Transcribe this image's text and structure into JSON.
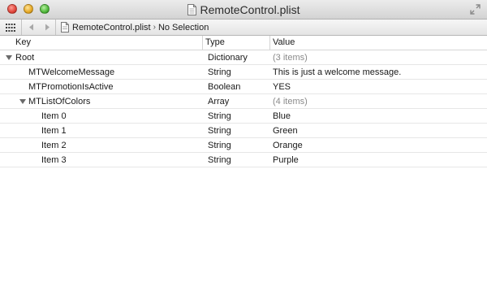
{
  "window": {
    "title": "RemoteControl.plist"
  },
  "jumpbar": {
    "file": "RemoteControl.plist",
    "selection": "No Selection",
    "separator": "›"
  },
  "columns": {
    "key": "Key",
    "type": "Type",
    "value": "Value"
  },
  "rows": [
    {
      "key": "Root",
      "type": "Dictionary",
      "value": "(3 items)",
      "indent": 0,
      "disclosure": "expanded",
      "value_muted": true
    },
    {
      "key": "MTWelcomeMessage",
      "type": "String",
      "value": "This is just a welcome message.",
      "indent": 1,
      "disclosure": "none",
      "value_muted": false
    },
    {
      "key": "MTPromotionIsActive",
      "type": "Boolean",
      "value": "YES",
      "indent": 1,
      "disclosure": "none",
      "value_muted": false
    },
    {
      "key": "MTListOfColors",
      "type": "Array",
      "value": "(4 items)",
      "indent": 1,
      "disclosure": "expanded",
      "value_muted": true
    },
    {
      "key": "Item 0",
      "type": "String",
      "value": "Blue",
      "indent": 2,
      "disclosure": "none",
      "value_muted": false
    },
    {
      "key": "Item 1",
      "type": "String",
      "value": "Green",
      "indent": 2,
      "disclosure": "none",
      "value_muted": false
    },
    {
      "key": "Item 2",
      "type": "String",
      "value": "Orange",
      "indent": 2,
      "disclosure": "none",
      "value_muted": false
    },
    {
      "key": "Item 3",
      "type": "String",
      "value": "Purple",
      "indent": 2,
      "disclosure": "none",
      "value_muted": false
    }
  ],
  "icons": {
    "close": "close-button",
    "minimize": "minimize-button",
    "zoom": "zoom-button",
    "document": "document-icon",
    "fullscreen": "fullscreen-icon",
    "related_items": "grid-icon",
    "back": "back-arrow-icon",
    "forward": "forward-arrow-icon",
    "disclosure": "disclosure-triangle-icon"
  }
}
